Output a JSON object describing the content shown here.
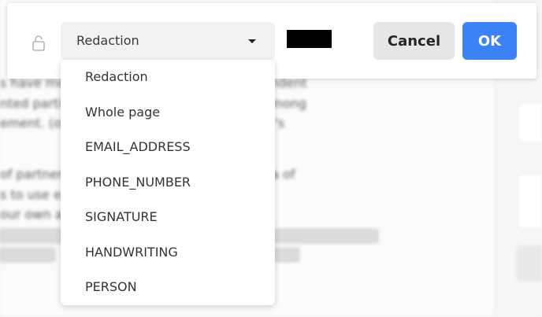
{
  "background_document": {
    "lines": [
      "s have met in consultation with the Independent",
      "nted parties, and members of the public, among",
      "ement. (or any government office or mayor's",
      "",
      "of partnership. ... develop and gives an idea of",
      "s to use each ... Standard Language, we",
      "our own and the ... to this preface. If",
      "",
      ""
    ]
  },
  "toolbar": {
    "lock_icon": "unlock-icon",
    "redaction_type": {
      "selected": "Redaction",
      "caret_icon": "caret-down-icon"
    },
    "fill_color": "#000000",
    "cancel_label": "Cancel",
    "ok_label": "OK",
    "ok_color": "#3b82f6"
  },
  "dropdown": {
    "options": [
      "Redaction",
      "Whole page",
      "EMAIL_ADDRESS",
      "PHONE_NUMBER",
      "SIGNATURE",
      "HANDWRITING",
      "PERSON"
    ]
  }
}
